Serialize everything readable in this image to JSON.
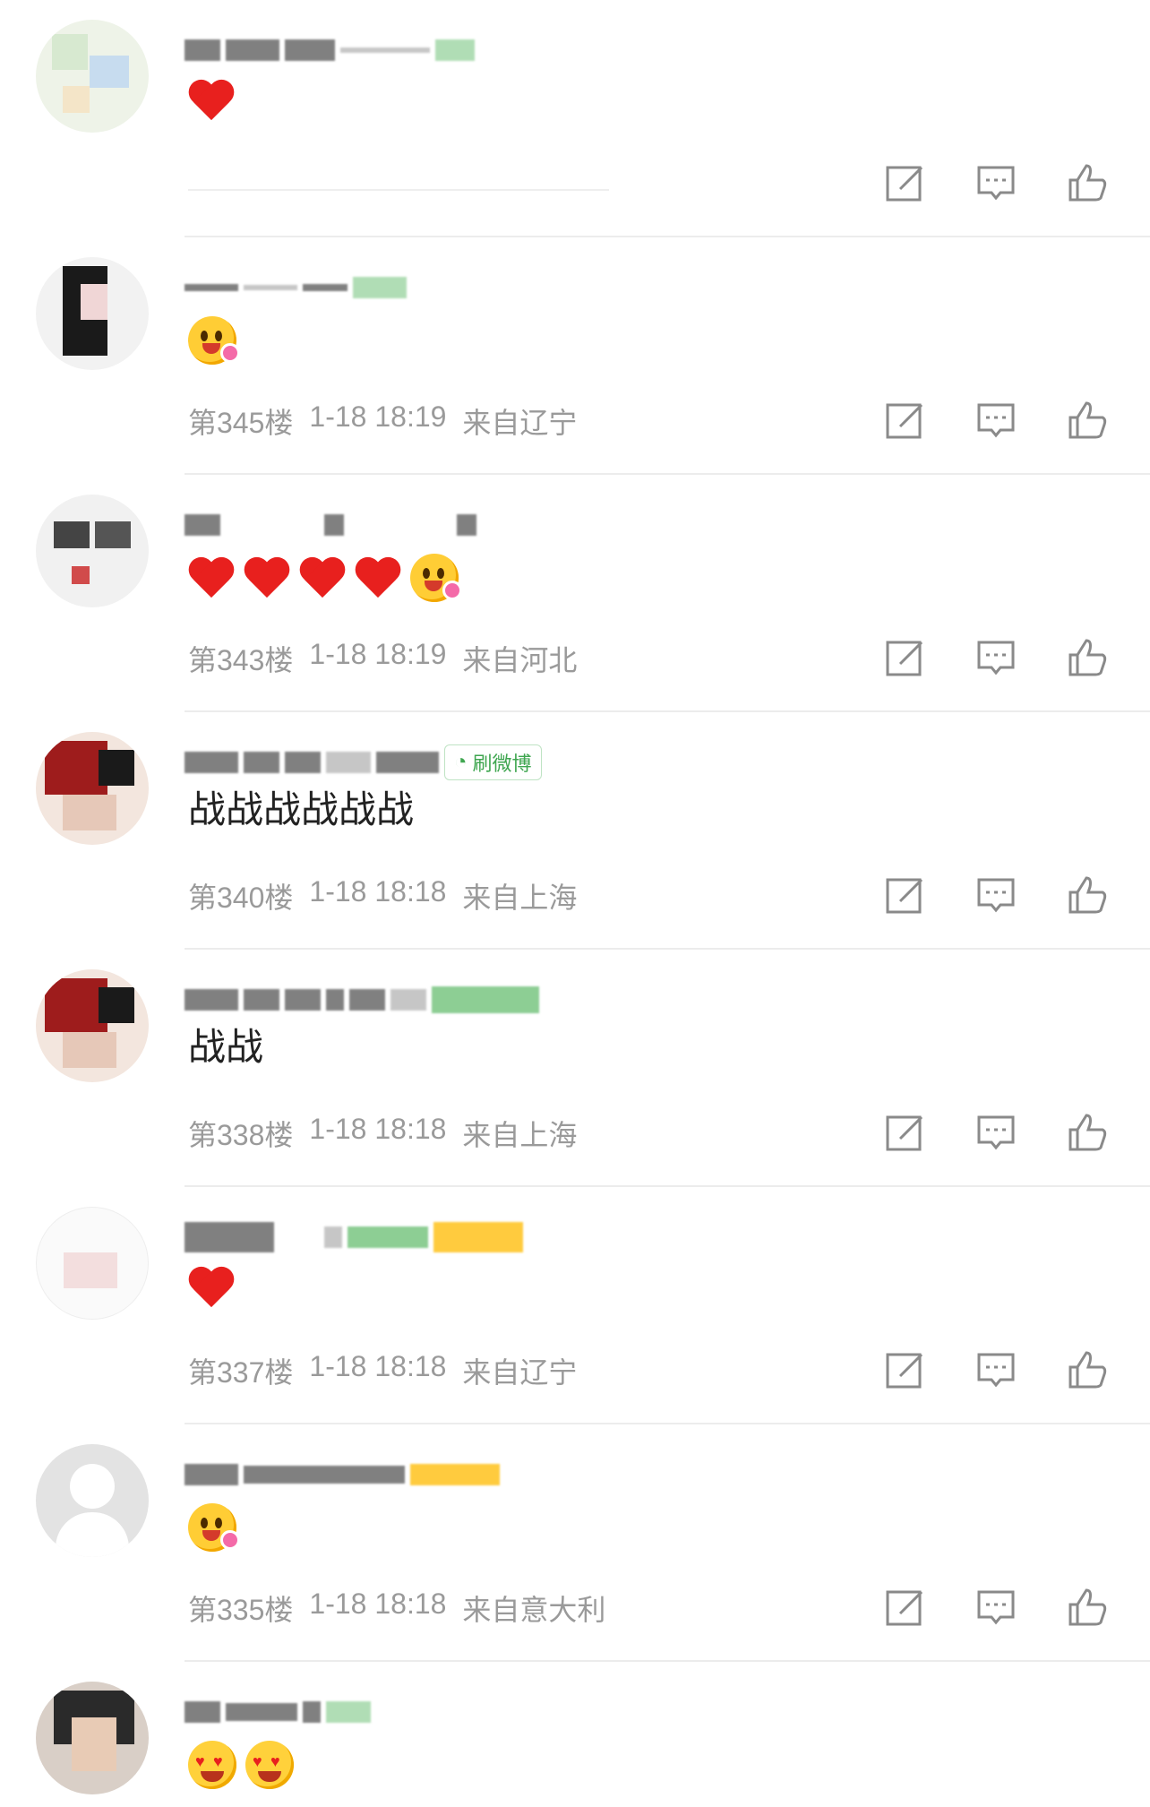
{
  "comments": [
    {
      "content_text": "",
      "content_emojis": [
        "red-heart"
      ],
      "meta": {
        "floor": "",
        "time": "",
        "location": ""
      },
      "badge": ""
    },
    {
      "content_text": "",
      "content_emojis": [
        "flower-face"
      ],
      "meta": {
        "floor": "第345楼",
        "time": "1-18 18:19",
        "location": "来自辽宁"
      },
      "badge": ""
    },
    {
      "content_text": "",
      "content_emojis": [
        "red-heart",
        "red-heart",
        "red-heart",
        "red-heart",
        "flower-face"
      ],
      "meta": {
        "floor": "第343楼",
        "time": "1-18 18:19",
        "location": "来自河北"
      },
      "badge": ""
    },
    {
      "content_text": "战战战战战战",
      "content_emojis": [],
      "meta": {
        "floor": "第340楼",
        "time": "1-18 18:18",
        "location": "来自上海"
      },
      "badge": "刷微博"
    },
    {
      "content_text": "战战",
      "content_emojis": [],
      "meta": {
        "floor": "第338楼",
        "time": "1-18 18:18",
        "location": "来自上海"
      },
      "badge": ""
    },
    {
      "content_text": "",
      "content_emojis": [
        "red-heart"
      ],
      "meta": {
        "floor": "第337楼",
        "time": "1-18 18:18",
        "location": "来自辽宁"
      },
      "badge": ""
    },
    {
      "content_text": "",
      "content_emojis": [
        "flower-face"
      ],
      "meta": {
        "floor": "第335楼",
        "time": "1-18 18:18",
        "location": "来自意大利"
      },
      "badge": ""
    },
    {
      "content_text": "",
      "content_emojis": [
        "heart-eyes-face",
        "heart-eyes-face"
      ],
      "meta": {
        "floor": "",
        "time": "",
        "location": ""
      },
      "badge": ""
    }
  ],
  "action_icons": [
    "compose-icon",
    "comment-icon",
    "like-icon"
  ],
  "colors": {
    "meta_text": "#9a9a9a",
    "badge_green": "#3fa650",
    "heart_red": "#e8201e",
    "divider": "#ececec"
  }
}
